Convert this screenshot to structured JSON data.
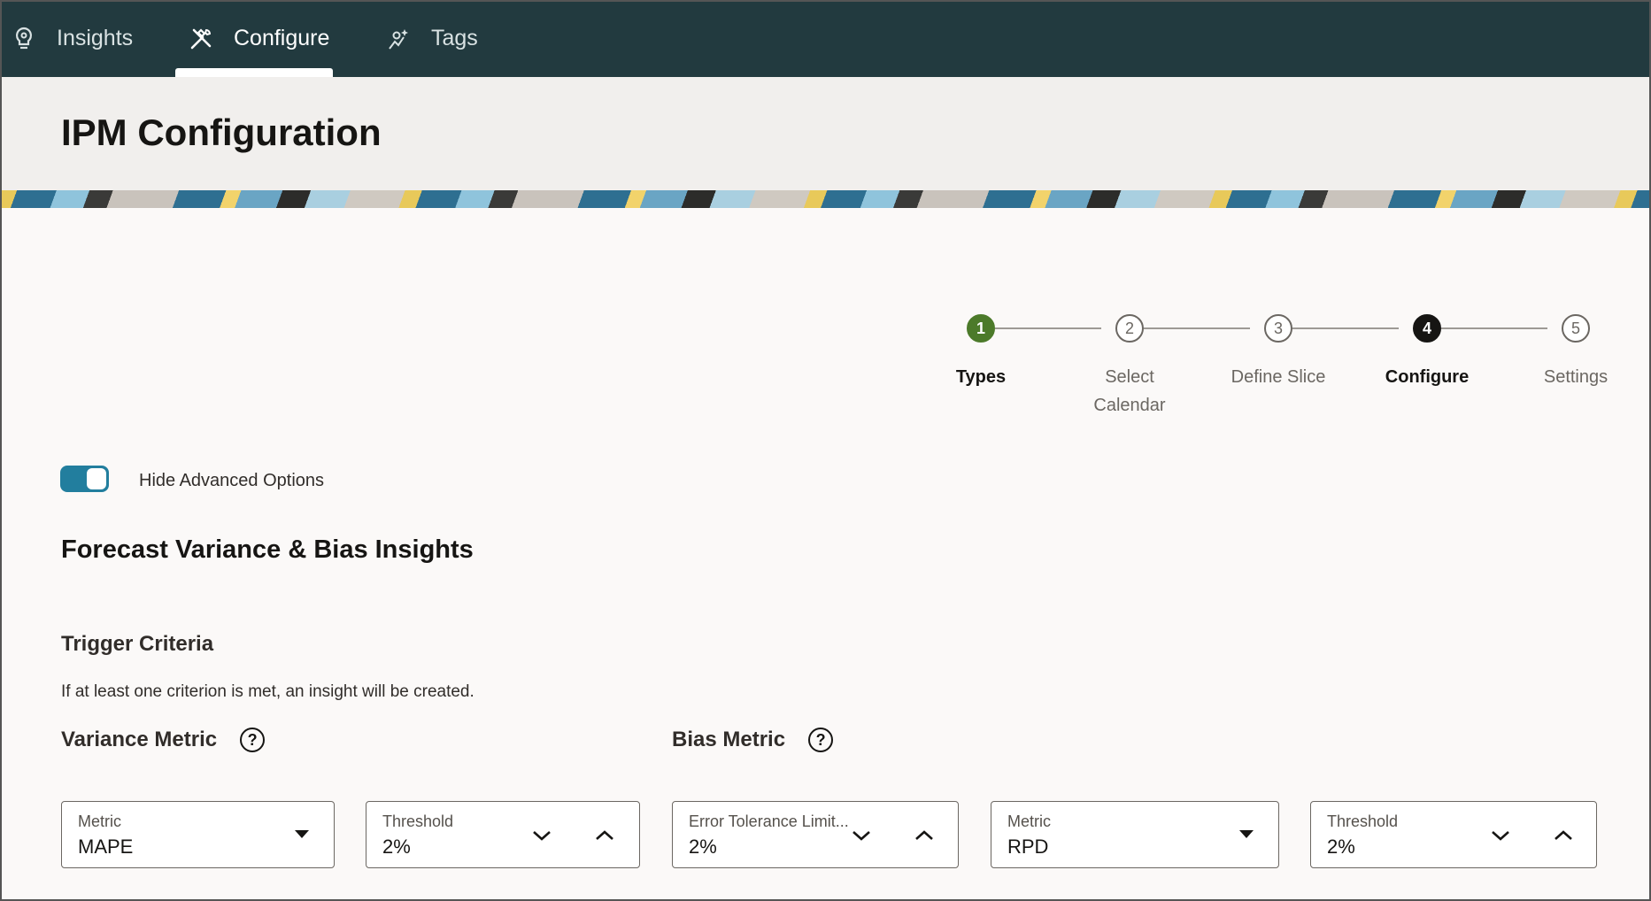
{
  "nav": {
    "items": [
      {
        "label": "Insights",
        "icon": "lightbulb-icon"
      },
      {
        "label": "Configure",
        "icon": "tools-icon",
        "active": true
      },
      {
        "label": "Tags",
        "icon": "sparkle-person-icon"
      }
    ]
  },
  "header": {
    "title": "IPM Configuration"
  },
  "stepper": {
    "steps": [
      {
        "number": "1",
        "label_line1": "Types",
        "label_line2": "",
        "state": "done"
      },
      {
        "number": "2",
        "label_line1": "Select",
        "label_line2": "Calendar",
        "state": "todo"
      },
      {
        "number": "3",
        "label_line1": "Define Slice",
        "label_line2": "",
        "state": "todo"
      },
      {
        "number": "4",
        "label_line1": "Configure",
        "label_line2": "",
        "state": "current"
      },
      {
        "number": "5",
        "label_line1": "Settings",
        "label_line2": "",
        "state": "todo"
      }
    ]
  },
  "advanced_toggle": {
    "label": "Hide Advanced Options",
    "on": true
  },
  "section": {
    "title": "Forecast Variance & Bias Insights",
    "trigger_title": "Trigger Criteria",
    "trigger_desc": "If at least one criterion is met, an insight will be created."
  },
  "variance": {
    "heading": "Variance Metric",
    "help": "?",
    "metric": {
      "label": "Metric",
      "value": "MAPE"
    },
    "threshold": {
      "label": "Threshold",
      "value": "2%"
    }
  },
  "bias": {
    "heading": "Bias Metric",
    "help": "?",
    "tolerance": {
      "label": "Error Tolerance Limit...",
      "value": "2%"
    },
    "metric": {
      "label": "Metric",
      "value": "RPD"
    },
    "threshold": {
      "label": "Threshold",
      "value": "2%"
    }
  },
  "colors": {
    "nav_bg": "#223a3f",
    "accent": "#227e9e",
    "step_done": "#4c7a2a"
  }
}
